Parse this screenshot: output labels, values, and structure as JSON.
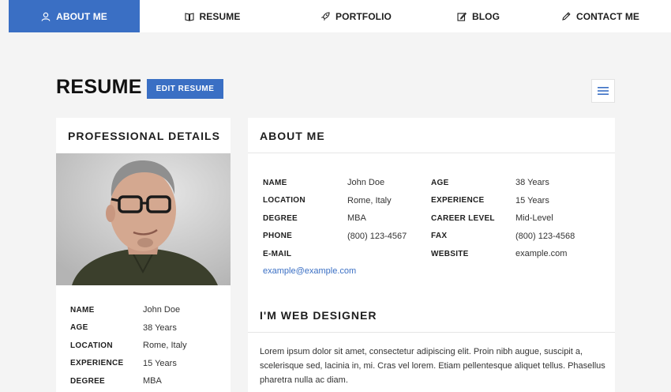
{
  "nav": {
    "items": [
      {
        "label": "ABOUT ME",
        "icon": "user-icon"
      },
      {
        "label": "RESUME",
        "icon": "book-icon"
      },
      {
        "label": "PORTFOLIO",
        "icon": "rocket-icon"
      },
      {
        "label": "BLOG",
        "icon": "edit-icon"
      },
      {
        "label": "CONTACT ME",
        "icon": "pencil-icon"
      }
    ],
    "active_index": 0
  },
  "header": {
    "title": "RESUME",
    "edit_label": "EDIT RESUME",
    "menu_icon": "hamburger-menu-icon"
  },
  "professional": {
    "title": "PROFESSIONAL DETAILS",
    "rows": [
      {
        "key": "NAME",
        "value": "John Doe"
      },
      {
        "key": "AGE",
        "value": "38 Years"
      },
      {
        "key": "LOCATION",
        "value": "Rome, Italy"
      },
      {
        "key": "EXPERIENCE",
        "value": "15 Years"
      },
      {
        "key": "DEGREE",
        "value": "MBA"
      }
    ]
  },
  "about": {
    "title": "ABOUT ME",
    "col1": [
      {
        "key": "NAME",
        "value": "John Doe"
      },
      {
        "key": "LOCATION",
        "value": "Rome, Italy"
      },
      {
        "key": "DEGREE",
        "value": "MBA"
      },
      {
        "key": "PHONE",
        "value": "(800) 123-4567"
      },
      {
        "key": "E-MAIL",
        "value": ""
      }
    ],
    "col2": [
      {
        "key": "AGE",
        "value": "38 Years"
      },
      {
        "key": "EXPERIENCE",
        "value": "15 Years"
      },
      {
        "key": "CAREER LEVEL",
        "value": "Mid-Level"
      },
      {
        "key": "FAX",
        "value": "(800) 123-4568"
      },
      {
        "key": "WEBSITE",
        "value": "example.com"
      }
    ],
    "email": "example@example.com",
    "subtitle": "I'M WEB DESIGNER",
    "text": "Lorem ipsum dolor sit amet, consectetur adipiscing elit. Proin nibh augue, suscipit a, scelerisque sed, lacinia in, mi. Cras vel lorem. Etiam pellentesque aliquet tellus. Phasellus pharetra nulla ac diam."
  },
  "colors": {
    "accent": "#3a6fc4",
    "background": "#f4f4f4"
  }
}
